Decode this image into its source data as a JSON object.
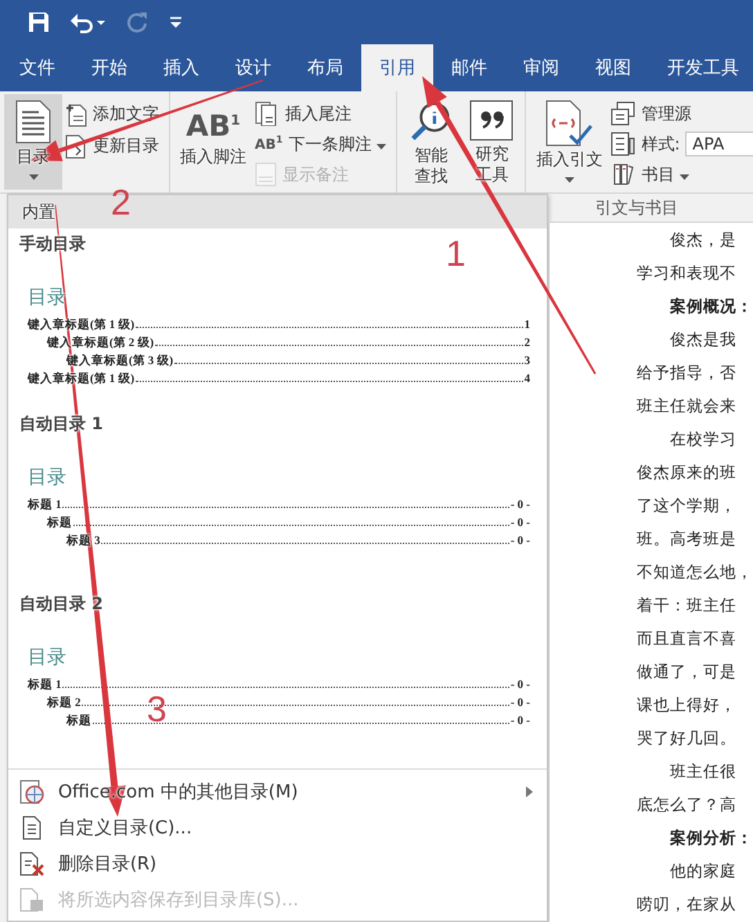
{
  "quick_access": [
    {
      "disabled": false
    },
    {
      "disabled": false
    },
    {
      "disabled": true
    },
    {
      "disabled": false
    }
  ],
  "tabs": [
    {
      "label": "文件",
      "selected": false
    },
    {
      "label": "开始",
      "selected": false
    },
    {
      "label": "插入",
      "selected": false
    },
    {
      "label": "设计",
      "selected": false
    },
    {
      "label": "布局",
      "selected": false
    },
    {
      "label": "引用",
      "selected": true
    },
    {
      "label": "邮件",
      "selected": false
    },
    {
      "label": "审阅",
      "selected": false
    },
    {
      "label": "视图",
      "selected": false
    },
    {
      "label": "开发工具",
      "selected": false
    }
  ],
  "ribbon": {
    "groups": [
      {
        "large": [
          {
            "lines": [
              "目录"
            ],
            "dropdown": true,
            "pressed": true
          }
        ],
        "small": [
          {
            "label": "添加文字",
            "disabled": false
          },
          {
            "label": "更新目录",
            "disabled": false
          }
        ]
      },
      {
        "large": [
          {
            "icon_text": "AB$^{1}$",
            "lines": [
              "插入脚注"
            ],
            "dropdown": false,
            "pressed": false
          }
        ],
        "small": [
          {
            "label": "插入尾注",
            "disabled": false
          },
          {
            "label": "下一条脚注",
            "icon_text": "AB$^{1}$",
            "dropdown": true,
            "disabled": false
          },
          {
            "label": "显示备注",
            "disabled": true
          }
        ]
      },
      {
        "large": [
          {
            "lines": [
              "智能",
              "查找"
            ],
            "dropdown": false,
            "pressed": false
          },
          {
            "lines": [
              "研究",
              "工具"
            ],
            "dropdown": false,
            "pressed": false
          }
        ]
      },
      {
        "label": "引文与书目",
        "large": [
          {
            "lines": [
              "插入引文"
            ],
            "dropdown": true,
            "pressed": false
          }
        ],
        "small": [
          {
            "label": "管理源",
            "disabled": false
          },
          {
            "label": "样式:",
            "kind": "field",
            "value": "APA",
            "disabled": false
          },
          {
            "label": "书目",
            "dropdown": true,
            "disabled": false
          }
        ]
      }
    ]
  },
  "toc_menu": {
    "header": "内置",
    "sections": [
      {
        "title": "手动目录",
        "heading": "目录",
        "entries": [
          {
            "text": "键入章标题(第 1 级)",
            "page": "1",
            "children": [
              {
                "text": "键入章标题(第 2 级)",
                "page": "2",
                "children": [
                  {
                    "text": "键入章标题(第 3 级)",
                    "page": "3"
                  }
                ]
              }
            ]
          },
          {
            "text": "键入章标题(第 1 级)",
            "page": "4"
          }
        ]
      },
      {
        "title": "自动目录 1",
        "heading": "目录",
        "entries": [
          {
            "text": "标题 1",
            "page": "- 0 -",
            "children": [
              {
                "text": "标题",
                "page": "- 0 -",
                "children": [
                  {
                    "text": "标题 3",
                    "page": "- 0 -"
                  }
                ]
              }
            ]
          }
        ]
      },
      {
        "title": "自动目录 2",
        "heading": "目录",
        "entries": [
          {
            "text": "标题 1",
            "page": "- 0 -",
            "children": [
              {
                "text": "标题 2",
                "page": "- 0 -",
                "children": [
                  {
                    "text": "标题",
                    "page": "- 0 -"
                  }
                ]
              }
            ]
          }
        ]
      }
    ],
    "items": [
      {
        "label": "Office.com 中的其他目录(M)",
        "submenu": true,
        "disabled": false
      },
      {
        "label": "自定义目录(C)...",
        "submenu": false,
        "disabled": false
      },
      {
        "label": "删除目录(R)",
        "submenu": false,
        "disabled": false
      },
      {
        "label": "将所选内容保存到目录库(S)...",
        "submenu": false,
        "disabled": true
      }
    ]
  },
  "document": {
    "lines": [
      {
        "kind": "indent",
        "text": "俊杰，是"
      },
      {
        "kind": "plain",
        "text": "学习和表现不"
      },
      {
        "kind": "heading",
        "text": "案例概况："
      },
      {
        "kind": "indent",
        "text": "俊杰是我"
      },
      {
        "kind": "plain",
        "text": "给予指导，否"
      },
      {
        "kind": "plain",
        "text": "班主任就会来"
      },
      {
        "kind": "indent",
        "text": "在校学习"
      },
      {
        "kind": "plain",
        "text": "俊杰原来的班"
      },
      {
        "kind": "plain",
        "text": "了这个学期，"
      },
      {
        "kind": "plain",
        "text": "班。高考班是"
      },
      {
        "kind": "plain",
        "text": "不知道怎么地，"
      },
      {
        "kind": "plain",
        "text": "着干：班主任"
      },
      {
        "kind": "plain",
        "text": "而且直言不喜"
      },
      {
        "kind": "plain",
        "text": "做通了，可是"
      },
      {
        "kind": "plain",
        "text": "课也上得好，"
      },
      {
        "kind": "plain",
        "text": "哭了好几回。"
      },
      {
        "kind": "indent",
        "text": "班主任很"
      },
      {
        "kind": "plain",
        "text": "底怎么了？高"
      },
      {
        "kind": "heading",
        "text": "案例分析："
      },
      {
        "kind": "indent",
        "text": "他的家庭"
      },
      {
        "kind": "plain",
        "text": "唠叨，在家从"
      }
    ]
  },
  "annotations": [
    {
      "label": "1"
    },
    {
      "label": "2"
    },
    {
      "label": "3"
    }
  ]
}
